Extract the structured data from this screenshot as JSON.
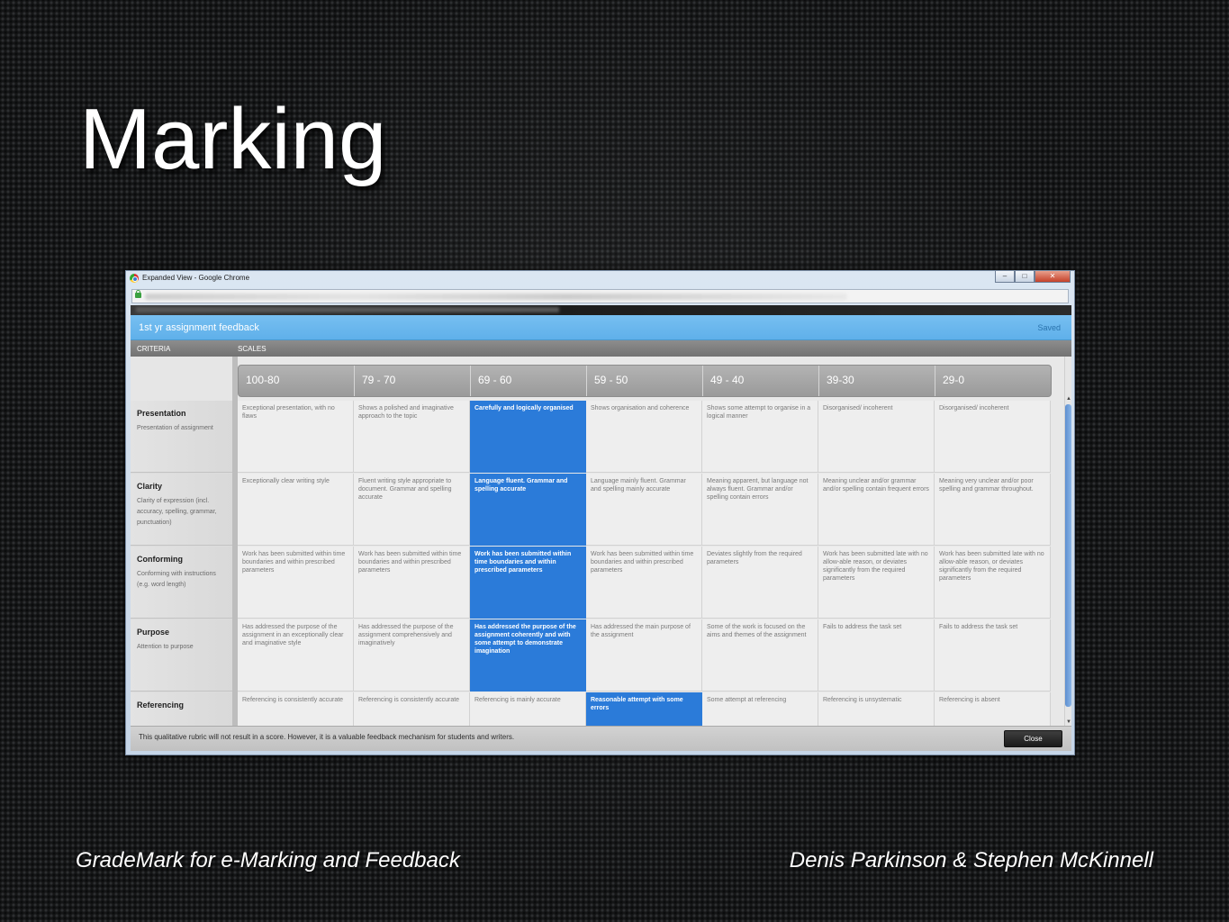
{
  "slide": {
    "title": "Marking",
    "footer_left": "GradeMark for e-Marking and Feedback",
    "footer_right": "Denis Parkinson & Stephen McKinnell"
  },
  "window": {
    "title": "Expanded View - Google Chrome",
    "controls": {
      "minimize": "–",
      "maximize": "□",
      "close": "✕"
    }
  },
  "rubric": {
    "title": "1st yr assignment feedback",
    "status": "Saved",
    "criteria_header": "CRITERIA",
    "scales_header": "SCALES",
    "scales": [
      "100-80",
      "79 - 70",
      "69 - 60",
      "59 - 50",
      "49 - 40",
      "39-30",
      "29-0"
    ],
    "selected_color": "#2b7bd9",
    "criteria": [
      {
        "name": "Presentation",
        "description": "Presentation of assignment",
        "selected": 2,
        "cells": [
          "Exceptional presentation, with no flaws",
          "Shows a polished and imaginative approach to the topic",
          "Carefully and logically organised",
          "Shows organisation and coherence",
          "Shows some attempt to organise in a logical manner",
          "Disorganised/ incoherent",
          "Disorganised/ incoherent"
        ]
      },
      {
        "name": "Clarity",
        "description": "Clarity of expression (incl. accuracy, spelling, grammar, punctuation)",
        "selected": 2,
        "cells": [
          "Exceptionally clear writing style",
          "Fluent writing style appropriate to document. Grammar and spelling accurate",
          "Language fluent. Grammar and spelling accurate",
          "Language mainly fluent. Grammar and spelling mainly accurate",
          "Meaning apparent, but language not always fluent. Grammar and/or spelling contain errors",
          "Meaning unclear and/or grammar and/or spelling contain frequent errors",
          "Meaning very unclear and/or poor spelling and grammar throughout."
        ]
      },
      {
        "name": "Conforming",
        "description": "Conforming with instructions (e.g. word length)",
        "selected": 2,
        "cells": [
          "Work has been submitted within time boundaries and within prescribed parameters",
          "Work has been submitted within time boundaries and within prescribed parameters",
          "Work has been submitted within time boundaries and within prescribed parameters",
          "Work has been submitted within time boundaries and within prescribed parameters",
          "Deviates slightly from the required parameters",
          "Work has been submitted late with no allow-able reason, or deviates significantly from the required parameters",
          "Work has been submitted late with no allow-able reason, or deviates significantly from the required parameters"
        ]
      },
      {
        "name": "Purpose",
        "description": "Attention to purpose",
        "selected": 2,
        "cells": [
          "Has addressed the purpose of the assignment in an exceptionally clear and imaginative style",
          "Has addressed the purpose of the assignment comprehensively and imaginatively",
          "Has addressed the purpose of the assignment coherently and with some attempt to demonstrate imagination",
          "Has addressed the main purpose of the assignment",
          "Some of the work is focused on the aims and themes of the assignment",
          "Fails to address the task set",
          "Fails to address the task set"
        ]
      },
      {
        "name": "Referencing",
        "description": "",
        "selected": 3,
        "cells": [
          "Referencing is consistently accurate",
          "Referencing is consistently accurate",
          "Referencing is mainly accurate",
          "Reasonable attempt with some errors",
          "Some attempt at referencing",
          "Referencing is unsystematic",
          "Referencing is absent"
        ]
      }
    ],
    "footer_note": "This qualitative rubric will not result in a score. However, it is a valuable feedback mechanism for students and writers.",
    "close_label": "Close",
    "scroll_up": "▲",
    "scroll_down": "▼"
  }
}
